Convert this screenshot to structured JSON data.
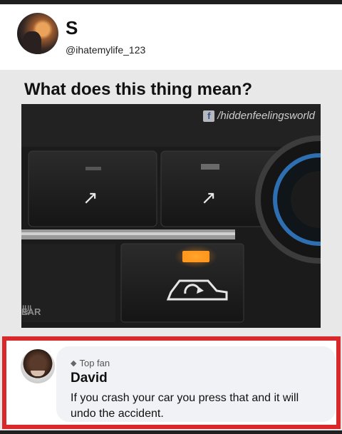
{
  "post": {
    "author_name": "S",
    "author_handle": "@ihatemylife_123",
    "question": "What does this thing mean?"
  },
  "photo": {
    "watermark": "/hiddenfeelingsworld",
    "watermark_icon": "f",
    "button_label_partial": "EAR"
  },
  "comment": {
    "badge": "Top fan",
    "badge_icon": "diamond-icon",
    "author": "David",
    "text": "If you crash your car you press that and it will undo the accident."
  },
  "colors": {
    "highlight_border": "#d9282a",
    "indicator_light": "#ff9a1f"
  }
}
